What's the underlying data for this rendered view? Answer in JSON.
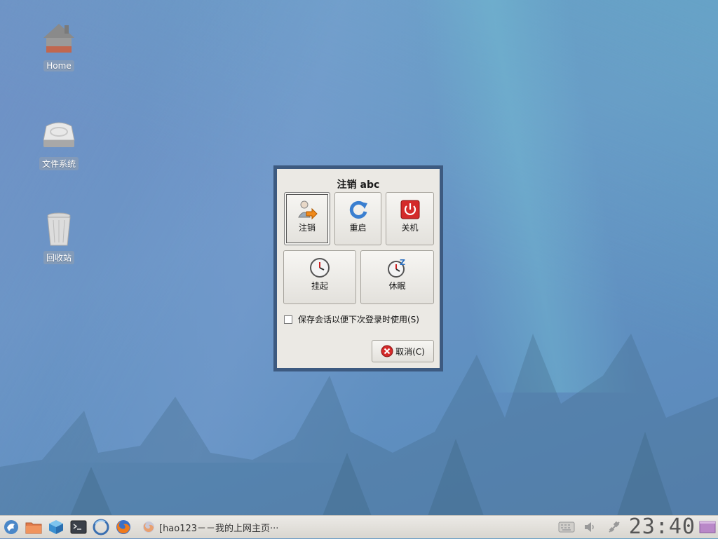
{
  "desktop": {
    "icons": [
      {
        "name": "home",
        "label": "Home"
      },
      {
        "name": "filesystem",
        "label": "文件系统"
      },
      {
        "name": "trash",
        "label": "回收站"
      }
    ]
  },
  "dialog": {
    "title": "注销 abc",
    "actions": {
      "logout": {
        "label": "注销",
        "icon": "logout-icon"
      },
      "restart": {
        "label": "重启",
        "icon": "restart-icon"
      },
      "shutdown": {
        "label": "关机",
        "icon": "power-icon"
      },
      "suspend": {
        "label": "挂起",
        "icon": "clock-icon"
      },
      "hibernate": {
        "label": "休眠",
        "icon": "sleep-clock-icon"
      }
    },
    "save_session": {
      "label": "保存会话以便下次登录时使用(S)",
      "checked": false
    },
    "cancel": {
      "label": "取消(C)",
      "icon": "cancel-icon"
    }
  },
  "taskbar": {
    "launchers": [
      "menu-icon",
      "folder-icon",
      "package-icon",
      "terminal-icon",
      "browser-icon",
      "firefox-icon"
    ],
    "task": {
      "title": "[hao123－－我的上网主页···",
      "icon": "firefox-icon"
    },
    "clock": "23:40",
    "tray": [
      "keyboard-icon",
      "volume-icon",
      "network-icon",
      "workspace-icon"
    ]
  },
  "colors": {
    "dialog_border": "#3d5a80",
    "dialog_bg": "#ebe9e4",
    "taskbar_bg": "#e3e0db"
  }
}
